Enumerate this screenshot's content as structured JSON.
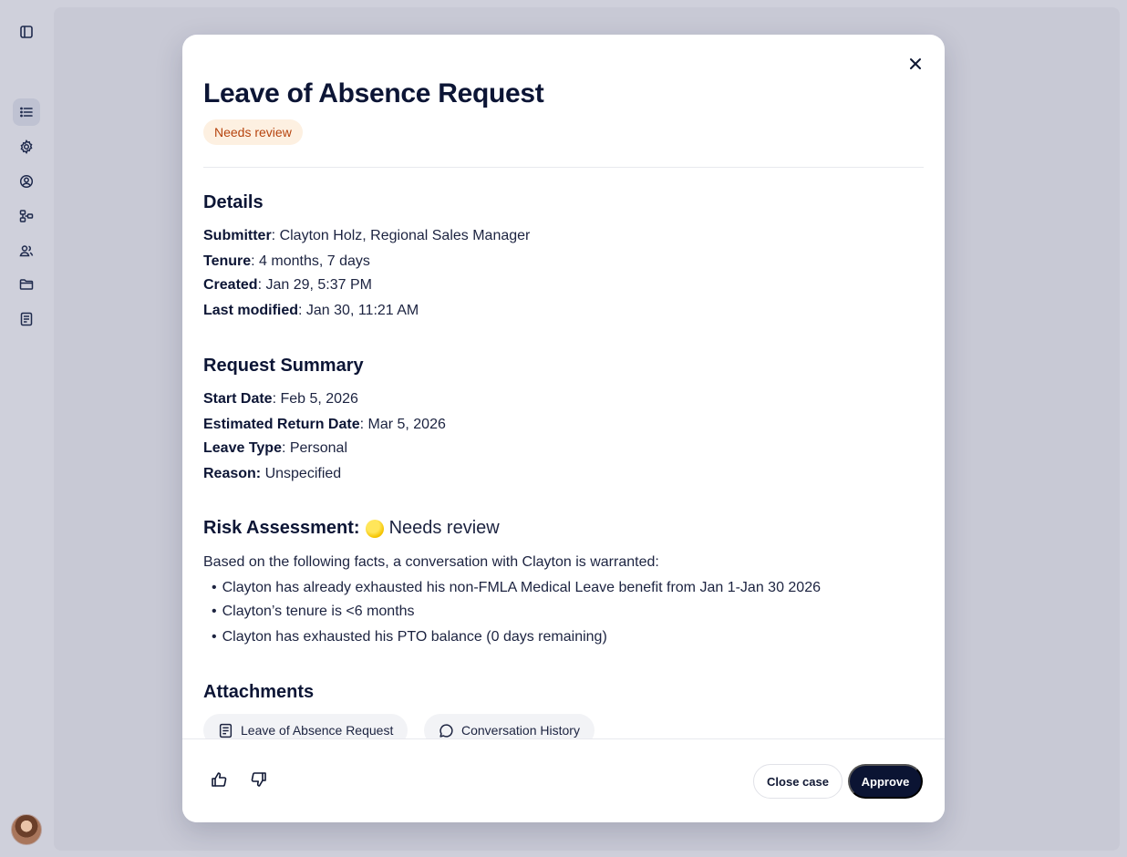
{
  "sidebar": {
    "toggle_icon": "panel-toggle-icon",
    "items": [
      {
        "icon": "list-icon",
        "active": true
      },
      {
        "icon": "gear-icon",
        "active": false
      },
      {
        "icon": "user-circle-icon",
        "active": false
      },
      {
        "icon": "org-chart-icon",
        "active": false
      },
      {
        "icon": "people-icon",
        "active": false
      },
      {
        "icon": "folder-icon",
        "active": false
      },
      {
        "icon": "document-icon",
        "active": false
      }
    ],
    "avatar_icon": "user-avatar"
  },
  "modal": {
    "title": "Leave of Absence Request",
    "status": "Needs review",
    "details": {
      "heading": "Details",
      "submitter_label": "Submitter",
      "submitter_value": ": Clayton Holz, Regional Sales Manager",
      "tenure_label": "Tenure",
      "tenure_value": ": 4 months, 7 days",
      "created_label": "Created",
      "created_value": ": Jan 29, 5:37 PM",
      "modified_label": "Last modified",
      "modified_value": ": Jan 30, 11:21 AM"
    },
    "summary": {
      "heading": "Request Summary",
      "start_label": "Start Date",
      "start_value": ": Feb 5, 2026",
      "return_label": "Estimated Return Date",
      "return_value": ": Mar 5, 2026",
      "type_label": "Leave Type",
      "type_value": ": Personal",
      "reason_label": "Reason:",
      "reason_value": " Unspecified"
    },
    "risk": {
      "heading": "Risk Assessment:",
      "status": "Needs review",
      "intro": "Based on the following facts, a conversation with Clayton is warranted:",
      "bullets": [
        "Clayton has already exhausted his non-FMLA Medical Leave benefit from Jan 1-Jan 30 2026",
        "Clayton’s tenure is <6 months",
        "Clayton has exhausted his PTO balance (0 days remaining)"
      ]
    },
    "attachments": {
      "heading": "Attachments",
      "items": [
        "Leave of Absence Request",
        "Conversation History"
      ]
    },
    "footer": {
      "close_case": "Close case",
      "approve": "Approve"
    }
  }
}
